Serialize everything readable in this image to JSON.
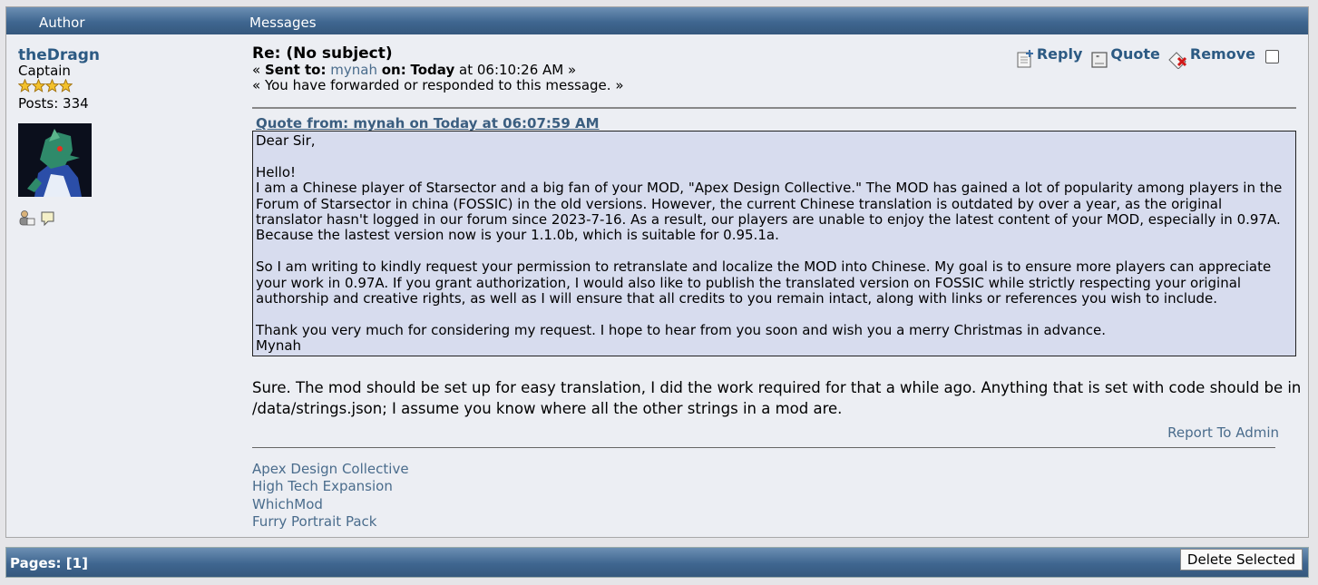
{
  "header": {
    "author_col": "Author",
    "messages_col": "Messages"
  },
  "author": {
    "name": "theDragn",
    "rank": "Captain",
    "stars": 4,
    "posts": "Posts: 334"
  },
  "message": {
    "subject": "Re: (No subject)",
    "sent_prefix": "« ",
    "sent_label": "Sent to:",
    "recipient": "mynah",
    "on_label": "on:",
    "day": "Today",
    "time": "at 06:10:26 AM »",
    "forwarded_note": "« You have forwarded or responded to this message. »",
    "actions": {
      "reply": "Reply",
      "quote": "Quote",
      "remove": "Remove"
    },
    "quote_header": "Quote from: mynah on Today at 06:07:59 AM",
    "quote_paragraphs": [
      "Dear Sir,",
      "",
      "Hello!",
      "I am a Chinese player of Starsector and a big fan of your MOD, \"Apex Design Collective.\" The MOD has gained a lot of popularity among players in the Forum of Starsector in china (FOSSIC) in the old versions. However, the current Chinese translation is outdated by over a year, as the original translator hasn't logged in our forum since 2023-7-16. As a result, our players are unable to enjoy the latest content of your MOD, especially in 0.97A. Because the lastest version now is your 1.1.0b, which is suitable for 0.95.1a.",
      "",
      "So I am writing to kindly request your permission to retranslate and localize the MOD into Chinese. My goal is to ensure more players can appreciate your work in 0.97A. If you grant authorization, I would also like to publish the translated version on FOSSIC while strictly respecting your original authorship and creative rights, as well as  I will ensure that all credits to you remain intact, along with links or references you wish to include.",
      "",
      "Thank you very much for considering my request. I hope to hear from you soon and wish you a merry Christmas in advance.",
      "Mynah"
    ],
    "reply_text": "Sure. The mod should be set up for easy translation, I did the work required for that a while ago. Anything that is set with code should be in /data/strings.json; I assume you know where all the other strings in a mod are.",
    "report_link": "Report To Admin",
    "signature_links": [
      "Apex Design Collective",
      "High Tech Expansion",
      "WhichMod",
      "Furry Portrait Pack"
    ]
  },
  "footer": {
    "pages_label": "Pages: [",
    "current_page": "1",
    "pages_close": "]",
    "delete_button": "Delete Selected"
  },
  "colors": {
    "header_gradient_top": "#6c8fb3",
    "header_gradient_bottom": "#35587d",
    "quote_bg": "#d7dcee",
    "link": "#4a6c8c",
    "name": "#2c5a83"
  },
  "icons": [
    "star-icon",
    "avatar",
    "profile-icon",
    "pm-icon",
    "reply-icon",
    "quote-icon",
    "remove-icon"
  ]
}
